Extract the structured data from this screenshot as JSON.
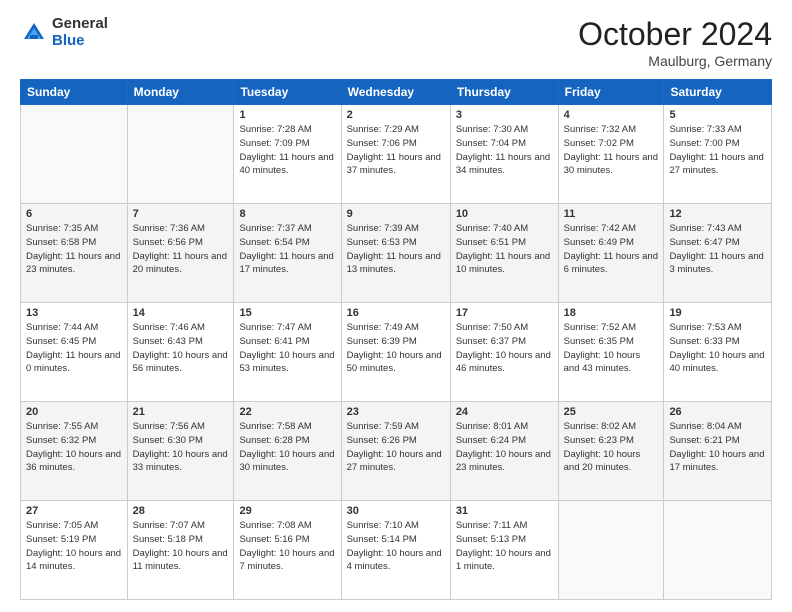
{
  "header": {
    "logo_general": "General",
    "logo_blue": "Blue",
    "month_title": "October 2024",
    "location": "Maulburg, Germany"
  },
  "weekdays": [
    "Sunday",
    "Monday",
    "Tuesday",
    "Wednesday",
    "Thursday",
    "Friday",
    "Saturday"
  ],
  "weeks": [
    [
      {
        "day": "",
        "info": ""
      },
      {
        "day": "",
        "info": ""
      },
      {
        "day": "1",
        "info": "Sunrise: 7:28 AM\nSunset: 7:09 PM\nDaylight: 11 hours and 40 minutes."
      },
      {
        "day": "2",
        "info": "Sunrise: 7:29 AM\nSunset: 7:06 PM\nDaylight: 11 hours and 37 minutes."
      },
      {
        "day": "3",
        "info": "Sunrise: 7:30 AM\nSunset: 7:04 PM\nDaylight: 11 hours and 34 minutes."
      },
      {
        "day": "4",
        "info": "Sunrise: 7:32 AM\nSunset: 7:02 PM\nDaylight: 11 hours and 30 minutes."
      },
      {
        "day": "5",
        "info": "Sunrise: 7:33 AM\nSunset: 7:00 PM\nDaylight: 11 hours and 27 minutes."
      }
    ],
    [
      {
        "day": "6",
        "info": "Sunrise: 7:35 AM\nSunset: 6:58 PM\nDaylight: 11 hours and 23 minutes."
      },
      {
        "day": "7",
        "info": "Sunrise: 7:36 AM\nSunset: 6:56 PM\nDaylight: 11 hours and 20 minutes."
      },
      {
        "day": "8",
        "info": "Sunrise: 7:37 AM\nSunset: 6:54 PM\nDaylight: 11 hours and 17 minutes."
      },
      {
        "day": "9",
        "info": "Sunrise: 7:39 AM\nSunset: 6:53 PM\nDaylight: 11 hours and 13 minutes."
      },
      {
        "day": "10",
        "info": "Sunrise: 7:40 AM\nSunset: 6:51 PM\nDaylight: 11 hours and 10 minutes."
      },
      {
        "day": "11",
        "info": "Sunrise: 7:42 AM\nSunset: 6:49 PM\nDaylight: 11 hours and 6 minutes."
      },
      {
        "day": "12",
        "info": "Sunrise: 7:43 AM\nSunset: 6:47 PM\nDaylight: 11 hours and 3 minutes."
      }
    ],
    [
      {
        "day": "13",
        "info": "Sunrise: 7:44 AM\nSunset: 6:45 PM\nDaylight: 11 hours and 0 minutes."
      },
      {
        "day": "14",
        "info": "Sunrise: 7:46 AM\nSunset: 6:43 PM\nDaylight: 10 hours and 56 minutes."
      },
      {
        "day": "15",
        "info": "Sunrise: 7:47 AM\nSunset: 6:41 PM\nDaylight: 10 hours and 53 minutes."
      },
      {
        "day": "16",
        "info": "Sunrise: 7:49 AM\nSunset: 6:39 PM\nDaylight: 10 hours and 50 minutes."
      },
      {
        "day": "17",
        "info": "Sunrise: 7:50 AM\nSunset: 6:37 PM\nDaylight: 10 hours and 46 minutes."
      },
      {
        "day": "18",
        "info": "Sunrise: 7:52 AM\nSunset: 6:35 PM\nDaylight: 10 hours and 43 minutes."
      },
      {
        "day": "19",
        "info": "Sunrise: 7:53 AM\nSunset: 6:33 PM\nDaylight: 10 hours and 40 minutes."
      }
    ],
    [
      {
        "day": "20",
        "info": "Sunrise: 7:55 AM\nSunset: 6:32 PM\nDaylight: 10 hours and 36 minutes."
      },
      {
        "day": "21",
        "info": "Sunrise: 7:56 AM\nSunset: 6:30 PM\nDaylight: 10 hours and 33 minutes."
      },
      {
        "day": "22",
        "info": "Sunrise: 7:58 AM\nSunset: 6:28 PM\nDaylight: 10 hours and 30 minutes."
      },
      {
        "day": "23",
        "info": "Sunrise: 7:59 AM\nSunset: 6:26 PM\nDaylight: 10 hours and 27 minutes."
      },
      {
        "day": "24",
        "info": "Sunrise: 8:01 AM\nSunset: 6:24 PM\nDaylight: 10 hours and 23 minutes."
      },
      {
        "day": "25",
        "info": "Sunrise: 8:02 AM\nSunset: 6:23 PM\nDaylight: 10 hours and 20 minutes."
      },
      {
        "day": "26",
        "info": "Sunrise: 8:04 AM\nSunset: 6:21 PM\nDaylight: 10 hours and 17 minutes."
      }
    ],
    [
      {
        "day": "27",
        "info": "Sunrise: 7:05 AM\nSunset: 5:19 PM\nDaylight: 10 hours and 14 minutes."
      },
      {
        "day": "28",
        "info": "Sunrise: 7:07 AM\nSunset: 5:18 PM\nDaylight: 10 hours and 11 minutes."
      },
      {
        "day": "29",
        "info": "Sunrise: 7:08 AM\nSunset: 5:16 PM\nDaylight: 10 hours and 7 minutes."
      },
      {
        "day": "30",
        "info": "Sunrise: 7:10 AM\nSunset: 5:14 PM\nDaylight: 10 hours and 4 minutes."
      },
      {
        "day": "31",
        "info": "Sunrise: 7:11 AM\nSunset: 5:13 PM\nDaylight: 10 hours and 1 minute."
      },
      {
        "day": "",
        "info": ""
      },
      {
        "day": "",
        "info": ""
      }
    ]
  ]
}
